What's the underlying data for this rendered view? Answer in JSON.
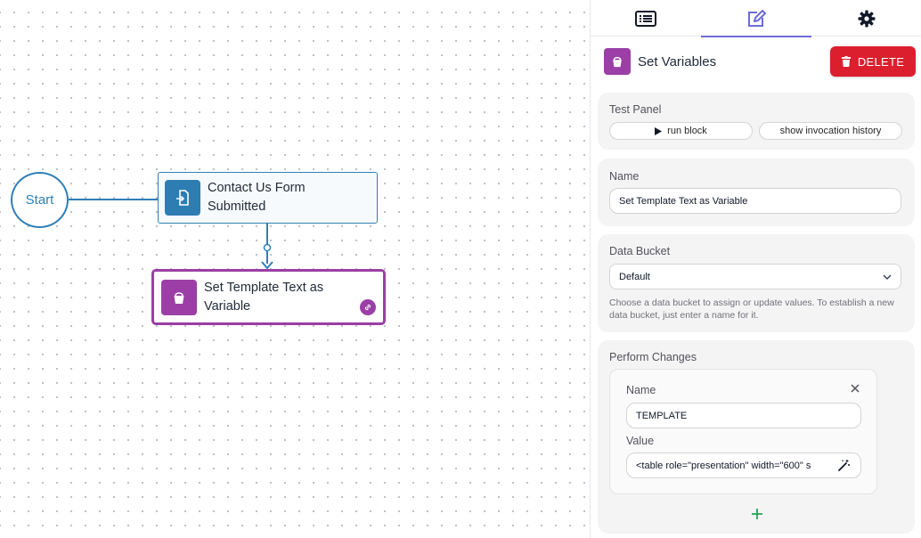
{
  "canvas": {
    "start_label": "Start",
    "trigger_node": {
      "label": "Contact Us Form Submitted",
      "color": "#2d7db3"
    },
    "action_node": {
      "label": "Set Template Text as Variable",
      "color": "#9b3fa6"
    }
  },
  "panel": {
    "tabs": [
      {
        "name": "list",
        "icon": "list-icon"
      },
      {
        "name": "edit",
        "icon": "edit-icon",
        "active": true
      },
      {
        "name": "settings",
        "icon": "gear-icon"
      }
    ],
    "title": "Set Variables",
    "delete_label": "DELETE",
    "test_panel": {
      "label": "Test Panel",
      "run_label": "run block",
      "history_label": "show invocation history"
    },
    "name_section": {
      "label": "Name",
      "value": "Set Template Text as Variable"
    },
    "data_bucket": {
      "label": "Data Bucket",
      "selected": "Default",
      "helper": "Choose a data bucket to assign or update values. To establish a new data bucket, just enter a name for it."
    },
    "perform_changes": {
      "label": "Perform Changes",
      "name_label": "Name",
      "name_value": "TEMPLATE",
      "value_label": "Value",
      "value_value": "<table role=\"presentation\" width=\"600\" s"
    }
  },
  "colors": {
    "accent": "#6d6bd8",
    "danger": "#dc1f2e",
    "trigger": "#2d7db3",
    "action": "#9b3fa6",
    "add": "#22a35a"
  }
}
